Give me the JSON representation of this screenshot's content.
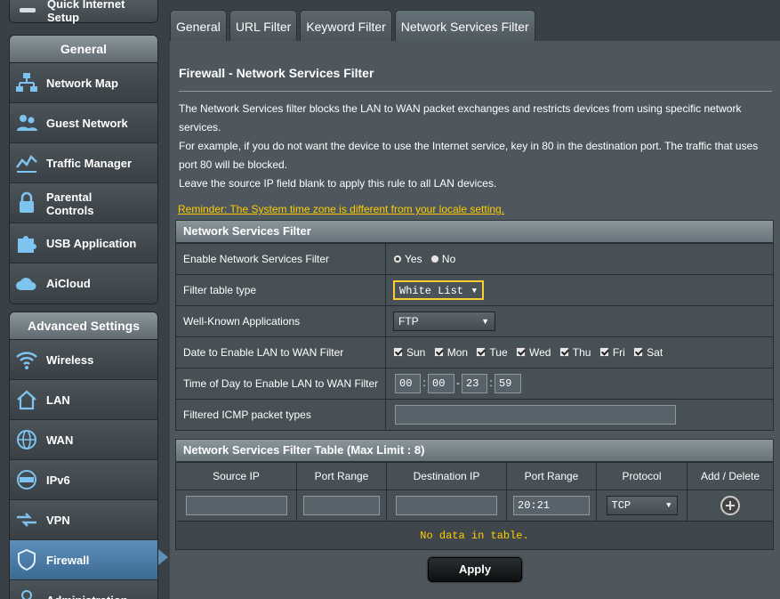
{
  "sidebar": {
    "quick_setup_label": "Quick Internet Setup",
    "general": {
      "header": "General",
      "items": [
        {
          "label": "Network Map",
          "icon": "network-map-icon"
        },
        {
          "label": "Guest Network",
          "icon": "guest-network-icon"
        },
        {
          "label": "Traffic Manager",
          "icon": "traffic-manager-icon"
        },
        {
          "label": "Parental Controls",
          "icon": "parental-controls-icon"
        },
        {
          "label": "USB Application",
          "icon": "usb-application-icon"
        },
        {
          "label": "AiCloud",
          "icon": "aicloud-icon"
        }
      ]
    },
    "advanced": {
      "header": "Advanced Settings",
      "items": [
        {
          "label": "Wireless",
          "icon": "wireless-icon"
        },
        {
          "label": "LAN",
          "icon": "lan-icon"
        },
        {
          "label": "WAN",
          "icon": "wan-icon"
        },
        {
          "label": "IPv6",
          "icon": "ipv6-icon"
        },
        {
          "label": "VPN",
          "icon": "vpn-icon"
        },
        {
          "label": "Firewall",
          "icon": "firewall-icon",
          "active": true
        },
        {
          "label": "Administration",
          "icon": "administration-icon"
        }
      ]
    }
  },
  "tabs": [
    {
      "label": "General"
    },
    {
      "label": "URL Filter"
    },
    {
      "label": "Keyword Filter"
    },
    {
      "label": "Network Services Filter",
      "active": true
    }
  ],
  "main": {
    "title": "Firewall - Network Services Filter",
    "description": [
      "The Network Services filter blocks the LAN to WAN packet exchanges and restricts devices from using specific network services.",
      "For example, if you do not want the device to use the Internet service, key in 80 in the destination port. The traffic that uses port 80 will be blocked.",
      "Leave the source IP field blank to apply this rule to all LAN devices."
    ],
    "reminder": "Reminder: The System time zone is different from your locale setting."
  },
  "filter_section": {
    "header": "Network Services Filter",
    "enable": {
      "label": "Enable Network Services Filter",
      "yes": "Yes",
      "no": "No",
      "selected": "Yes"
    },
    "table_type": {
      "label": "Filter table type",
      "value": "White List"
    },
    "well_known": {
      "label": "Well-Known Applications",
      "value": "FTP"
    },
    "date": {
      "label": "Date to Enable LAN to WAN Filter",
      "days": [
        "Sun",
        "Mon",
        "Tue",
        "Wed",
        "Thu",
        "Fri",
        "Sat"
      ]
    },
    "time": {
      "label": "Time of Day to Enable LAN to WAN Filter",
      "start_hour": "00",
      "start_min": "00",
      "end_hour": "23",
      "end_min": "59"
    },
    "icmp": {
      "label": "Filtered ICMP packet types",
      "value": ""
    }
  },
  "rule_table": {
    "header": "Network Services Filter Table (Max Limit : 8)",
    "columns": [
      "Source IP",
      "Port Range",
      "Destination IP",
      "Port Range",
      "Protocol",
      "Add / Delete"
    ],
    "new_row": {
      "source_ip": "",
      "src_port": "",
      "dest_ip": "",
      "dest_port": "20:21",
      "protocol": "TCP"
    },
    "empty_text": "No data in table."
  },
  "apply_label": "Apply",
  "colors": {
    "accent_yellow": "#ffcc00",
    "active_blue": "#5e8fb8",
    "panel": "#4d575d"
  }
}
